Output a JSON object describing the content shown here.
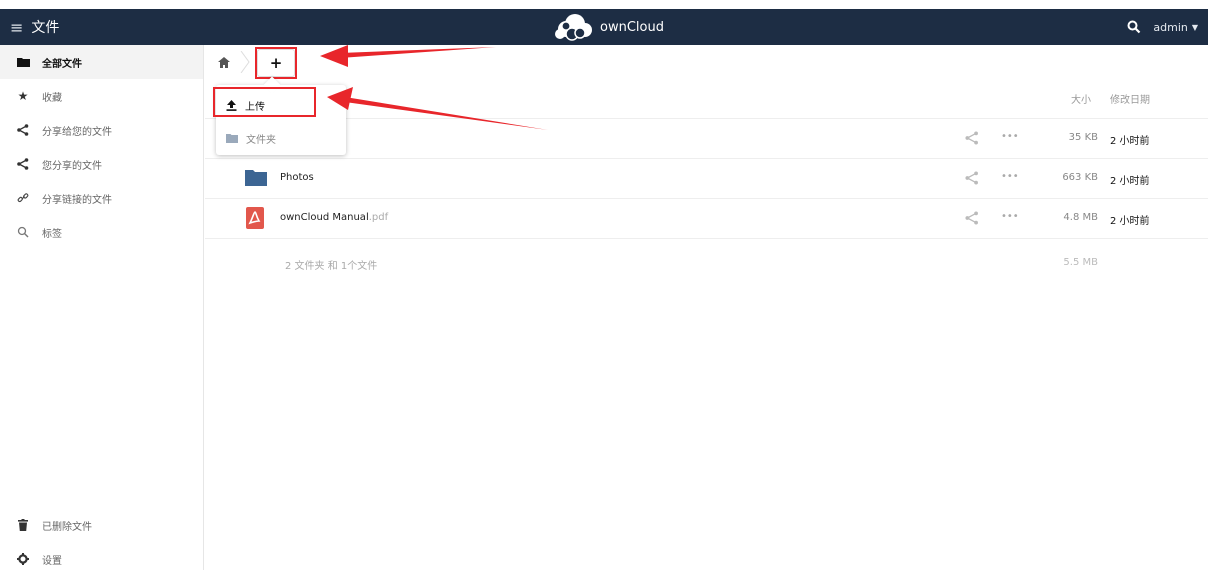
{
  "header": {
    "menu_icon": "hamburger-icon",
    "title": "文件",
    "logo_text": "ownCloud",
    "search_icon": "search-icon",
    "user": "admin",
    "bg_color": "#1d2d44"
  },
  "sidebar": {
    "items": [
      {
        "label": "全部文件",
        "icon": "folder-icon"
      },
      {
        "label": "收藏",
        "icon": "star-icon"
      },
      {
        "label": "分享给您的文件",
        "icon": "share-icon"
      },
      {
        "label": "您分享的文件",
        "icon": "share-icon"
      },
      {
        "label": "分享链接的文件",
        "icon": "link-icon"
      },
      {
        "label": "标签",
        "icon": "search-icon"
      }
    ],
    "bottom": [
      {
        "label": "已删除文件",
        "icon": "trash-icon"
      },
      {
        "label": "设置",
        "icon": "gear-icon"
      }
    ]
  },
  "toolbar": {
    "plus_label": "+"
  },
  "dropdown": {
    "upload": "上传",
    "folder": "文件夹"
  },
  "table": {
    "col_size": "大小",
    "col_date": "修改日期",
    "rows": [
      {
        "name": "",
        "ext": "",
        "size": "35 KB",
        "date": "2 小时前"
      },
      {
        "name": "Photos",
        "ext": "",
        "size": "663 KB",
        "date": "2 小时前"
      },
      {
        "name": "ownCloud Manual",
        "ext": ".pdf",
        "size": "4.8 MB",
        "date": "2 小时前"
      }
    ],
    "summary": "2 文件夹 和 1个文件",
    "summary_size": "5.5 MB"
  },
  "colors": {
    "accent_highlight": "#e8262b",
    "folder_blue": "#3c6593",
    "pdf_red": "#e2574c"
  }
}
